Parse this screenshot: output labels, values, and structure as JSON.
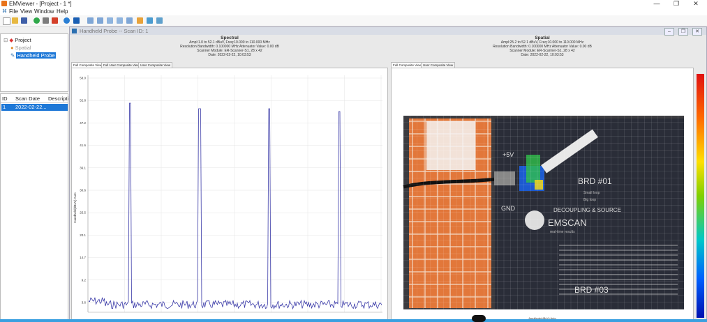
{
  "window": {
    "title": "EMViewer - [Project - 1 *]"
  },
  "menu": [
    "File",
    "View",
    "Window",
    "Help"
  ],
  "tree": {
    "root": "Project",
    "children": [
      "Spatial",
      "Handheld Probe"
    ]
  },
  "scan_list": {
    "columns": [
      "ID",
      "Scan Date",
      "Descripti"
    ],
    "rows": [
      {
        "id": "1",
        "date": "2022-02-22...",
        "desc": ""
      }
    ]
  },
  "document": {
    "title": "Handheld Probe -- Scan ID: 1"
  },
  "spectral": {
    "title": "Spectral",
    "info": [
      "Ampl:1.0 to 52.1 dBuV, Freq:10.000 to 110.000 MHz",
      "Resolution Bandwidth: 0.100000 MHz   Attenuator Value: 0.00 dB",
      "Scanner Module: ER-Scanner-S1, 28 x 42",
      "Date: 2022-02-22, 10:03:53"
    ],
    "tabs": [
      "Full Composite View",
      "Full User Composite View",
      "User Composite View"
    ],
    "ylabel": "Handheld(dBuV) Auto",
    "yticks": [
      "58.0",
      "52.8",
      "47.2",
      "41.6",
      "36.1",
      "30.6",
      "25.5",
      "20.1",
      "14.7",
      "9.2",
      "3.6"
    ]
  },
  "spatial": {
    "title": "Spatial",
    "info": [
      "Ampl:25.2 to 52.1 dBuV, Freq:10.000 to 110.000 MHz",
      "Resolution Bandwidth: 0.100000 MHz   Attenuator Value: 0.00 dB",
      "Scanner Module: ER-Scanner-S1, 28 x 42",
      "Date: 2022-02-22, 10:03:53"
    ],
    "tabs": [
      "Full Composite View",
      "User Composite View"
    ],
    "xlabel": "Amplitude(dBuV) Auto"
  },
  "board": {
    "label_5v": "+5V",
    "label_gnd": "GND",
    "brd1": "BRD #01",
    "brd3": "BRD #03",
    "brand": "EMSCAN",
    "tagline": "real-time results",
    "heading": "DECOUPLING & SOURCE",
    "small_loop": "Small loop",
    "big_loop": "Big loop"
  },
  "colors": {
    "accent": "#1e78d7",
    "trace": "#3a3aa8"
  }
}
